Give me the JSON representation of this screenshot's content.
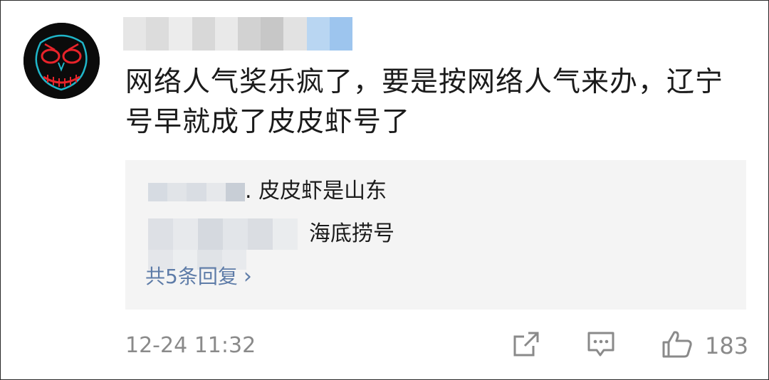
{
  "comment": {
    "text": "网络人气奖乐疯了，要是按网络人气来办，辽宁号早就成了皮皮虾号了",
    "timestamp": "12-24 11:32",
    "like_count": "183"
  },
  "replies": {
    "items": [
      {
        "text": ". 皮皮虾是山东"
      },
      {
        "text": "海底捞号"
      }
    ],
    "more_label": "共5条回复",
    "chevron": "›"
  },
  "icons": {
    "avatar": "skull-mask-avatar",
    "share": "share-icon",
    "comment": "comment-icon",
    "like": "thumbs-up-icon"
  },
  "colors": {
    "link": "#5e7ca8",
    "meta_text": "#8a8a8a",
    "reply_background": "#f4f4f4",
    "avatar_glow_red": "#e8232a",
    "avatar_glow_cyan": "#1fb6c9"
  }
}
